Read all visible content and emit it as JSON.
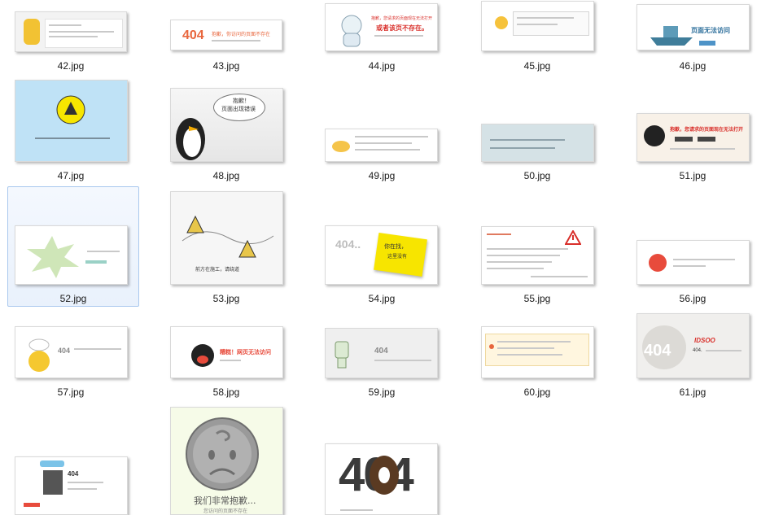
{
  "files": [
    {
      "name": "42.jpg",
      "selected": false
    },
    {
      "name": "43.jpg",
      "selected": false
    },
    {
      "name": "44.jpg",
      "selected": false
    },
    {
      "name": "45.jpg",
      "selected": false
    },
    {
      "name": "46.jpg",
      "selected": false
    },
    {
      "name": "47.jpg",
      "selected": false
    },
    {
      "name": "48.jpg",
      "selected": false
    },
    {
      "name": "49.jpg",
      "selected": false
    },
    {
      "name": "50.jpg",
      "selected": false
    },
    {
      "name": "51.jpg",
      "selected": false
    },
    {
      "name": "52.jpg",
      "selected": true
    },
    {
      "name": "53.jpg",
      "selected": false
    },
    {
      "name": "54.jpg",
      "selected": false
    },
    {
      "name": "55.jpg",
      "selected": false
    },
    {
      "name": "56.jpg",
      "selected": false
    },
    {
      "name": "57.jpg",
      "selected": false
    },
    {
      "name": "58.jpg",
      "selected": false
    },
    {
      "name": "59.jpg",
      "selected": false
    },
    {
      "name": "60.jpg",
      "selected": false
    },
    {
      "name": "61.jpg",
      "selected": false
    }
  ],
  "thumb_text": {
    "t43_404": "404",
    "t43_msg": "抱歉，你访问的页面不存在",
    "t44_l1": "抱歉，您请求的页面现在无法打开",
    "t44_l2": "或者该页不存在。",
    "t46_msg": "页面无法访问",
    "t48_bubble_l1": "抱歉！",
    "t48_bubble_l2": "页面出现错误",
    "t51_msg": "抱歉，您请求的页面现在无法打开",
    "t53_msg": "前方在施工，请绕道",
    "t54_404": "404..",
    "t54_note_l1": "你在找，",
    "t54_note_l2": "这里没有",
    "t57_404": "404",
    "t58_msg": "糟糕！网页无法访问",
    "t59_404": "404",
    "t61_404": "404",
    "t61_brand": "IDSOO",
    "t61_label": "404.",
    "t63_l1": "我们非常抱歉...",
    "t63_l2": "您访问的页面不存在",
    "t64_404": "404",
    "t62_404": "404"
  },
  "colors": {
    "selection_border": "#a9c8ee",
    "selection_fill": "#eef4fd",
    "accent_orange": "#e8663d",
    "accent_red": "#d9302b"
  }
}
